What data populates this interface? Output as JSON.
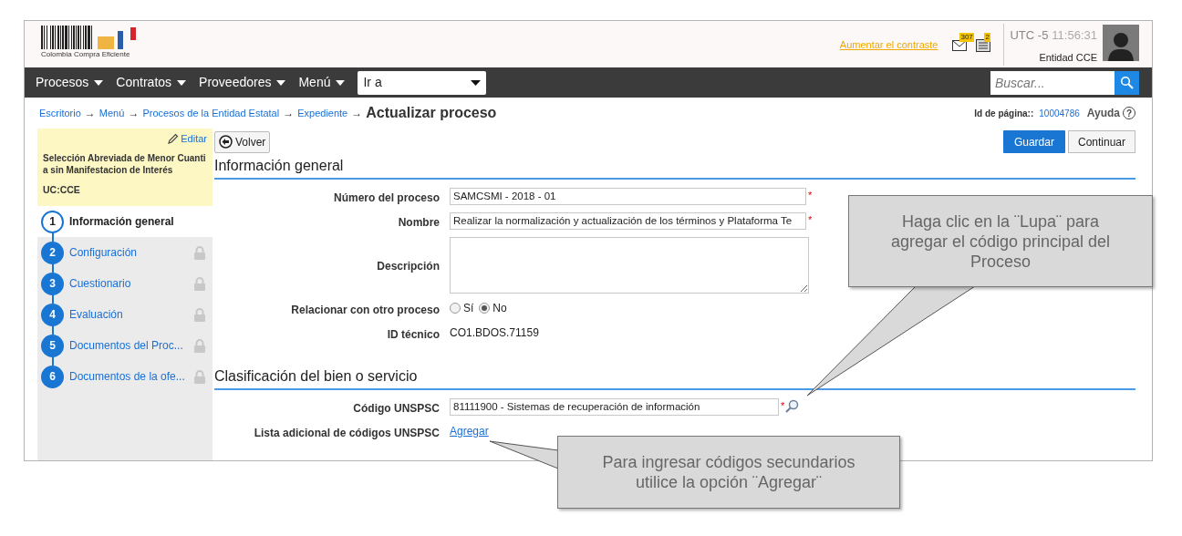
{
  "header": {
    "logo_text": "Colombia Compra Eficiente",
    "contrast_link": "Aumentar el contraste",
    "mail_count": "307",
    "notice_count": "2",
    "timezone": "UTC -5",
    "time": "11:56:31",
    "entity": "Entidad CCE"
  },
  "nav": {
    "items": [
      "Procesos",
      "Contratos",
      "Proveedores",
      "Menú"
    ],
    "goto": "Ir a",
    "search_placeholder": "Buscar..."
  },
  "breadcrumb": [
    {
      "label": "Escritorio",
      "separator": "→"
    },
    {
      "label": "Menú",
      "separator": "→"
    },
    {
      "label": "Procesos de la Entidad Estatal",
      "separator": "→"
    },
    {
      "label": "Expediente",
      "separator": "→"
    }
  ],
  "page_title": "Actualizar proceso",
  "page_id_label": "Id de página::",
  "page_id": "10004786",
  "help": "Ayuda",
  "help_icon": "?",
  "sidebar": {
    "edit": "Editar",
    "process_type": "Selección Abreviada de Menor Cuantia sin Manifestacion de Interés",
    "uc": "UC:CCE",
    "steps": [
      {
        "number": "1",
        "label": "Información general",
        "selected": true,
        "locked": false
      },
      {
        "number": "2",
        "label": "Configuración",
        "selected": false,
        "locked": true
      },
      {
        "number": "3",
        "label": "Cuestionario",
        "selected": false,
        "locked": true
      },
      {
        "number": "4",
        "label": "Evaluación",
        "selected": false,
        "locked": true
      },
      {
        "number": "5",
        "label": "Documentos del Proc...",
        "selected": false,
        "locked": true
      },
      {
        "number": "6",
        "label": "Documentos de la ofe...",
        "selected": false,
        "locked": true
      }
    ]
  },
  "buttons": {
    "back": "Volver",
    "save": "Guardar",
    "continue": "Continuar"
  },
  "sections": [
    {
      "title": "Información general",
      "fields": [
        {
          "kind": "text",
          "label": "Número del proceso",
          "value": "SAMCSMI - 2018 - 01",
          "required_mark": "*"
        },
        {
          "kind": "text",
          "label": "Nombre",
          "value": "Realizar la normalización y actualización de los términos y Plataforma Te",
          "required_mark": "*"
        },
        {
          "kind": "textarea",
          "label": "Descripción"
        },
        {
          "kind": "radio",
          "label": "Relacionar con otro proceso",
          "options": [
            {
              "label": "Sí",
              "selected": false
            },
            {
              "label": "No",
              "selected": true
            }
          ]
        },
        {
          "kind": "static",
          "label": "ID técnico",
          "value": "CO1.BDOS.71159"
        }
      ]
    },
    {
      "title": "Clasificación del bien o servicio",
      "fields": [
        {
          "kind": "lookup",
          "label": "Código UNSPSC",
          "value": "81111900 - Sistemas de recuperación de información",
          "required_mark": "*"
        },
        {
          "kind": "link",
          "label": "Lista adicional de códigos UNSPSC",
          "value": "Agregar"
        }
      ]
    }
  ],
  "callouts": [
    {
      "text": "Haga clic en la ¨Lupa¨ para agregar el código principal del Proceso"
    },
    {
      "text": "Para ingresar códigos secundarios utilice la opción ¨Agregar¨"
    }
  ]
}
